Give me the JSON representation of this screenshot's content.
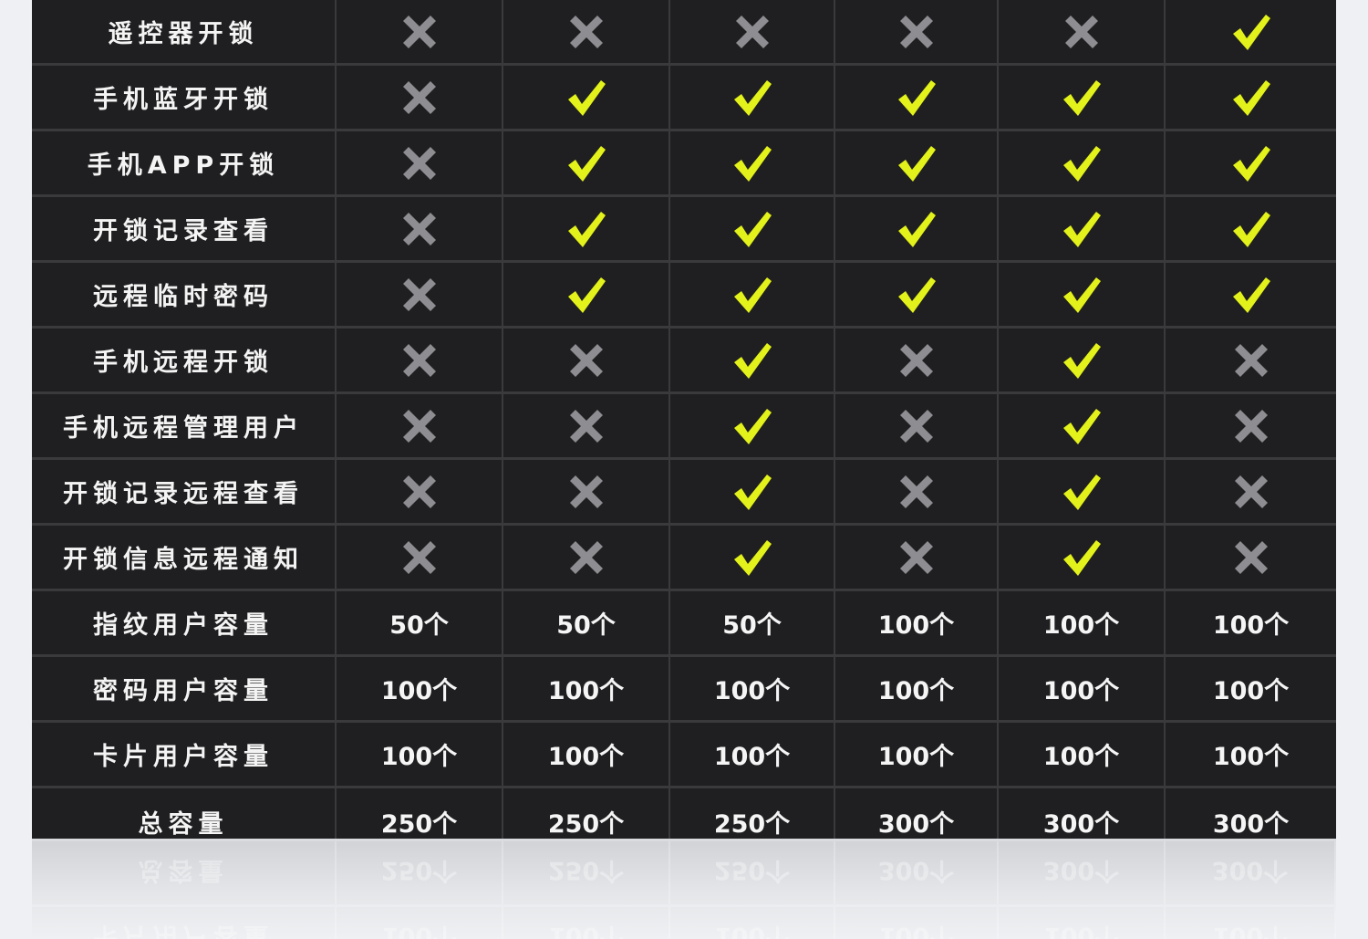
{
  "colors": {
    "check": "#e3f21a",
    "cross": "#8e8e92",
    "row_bg": "#1f1f21",
    "grid": "#3a3a3c"
  },
  "feature_rows": [
    {
      "label": "遥控器开锁",
      "marks": [
        false,
        false,
        false,
        false,
        false,
        true
      ]
    },
    {
      "label": "手机蓝牙开锁",
      "marks": [
        false,
        true,
        true,
        true,
        true,
        true
      ]
    },
    {
      "label": "手机APP开锁",
      "marks": [
        false,
        true,
        true,
        true,
        true,
        true
      ]
    },
    {
      "label": "开锁记录查看",
      "marks": [
        false,
        true,
        true,
        true,
        true,
        true
      ]
    },
    {
      "label": "远程临时密码",
      "marks": [
        false,
        true,
        true,
        true,
        true,
        true
      ]
    },
    {
      "label": "手机远程开锁",
      "marks": [
        false,
        false,
        true,
        false,
        true,
        false
      ]
    },
    {
      "label": "手机远程管理用户",
      "marks": [
        false,
        false,
        true,
        false,
        true,
        false
      ]
    },
    {
      "label": "开锁记录远程查看",
      "marks": [
        false,
        false,
        true,
        false,
        true,
        false
      ]
    },
    {
      "label": "开锁信息远程通知",
      "marks": [
        false,
        false,
        true,
        false,
        true,
        false
      ]
    }
  ],
  "value_rows": [
    {
      "label": "指纹用户容量",
      "values": [
        "50个",
        "50个",
        "50个",
        "100个",
        "100个",
        "100个"
      ]
    },
    {
      "label": "密码用户容量",
      "values": [
        "100个",
        "100个",
        "100个",
        "100个",
        "100个",
        "100个"
      ]
    },
    {
      "label": "卡片用户容量",
      "values": [
        "100个",
        "100个",
        "100个",
        "100个",
        "100个",
        "100个"
      ]
    },
    {
      "label": "总容量",
      "values": [
        "250个",
        "250个",
        "250个",
        "300个",
        "300个",
        "300个"
      ]
    }
  ]
}
